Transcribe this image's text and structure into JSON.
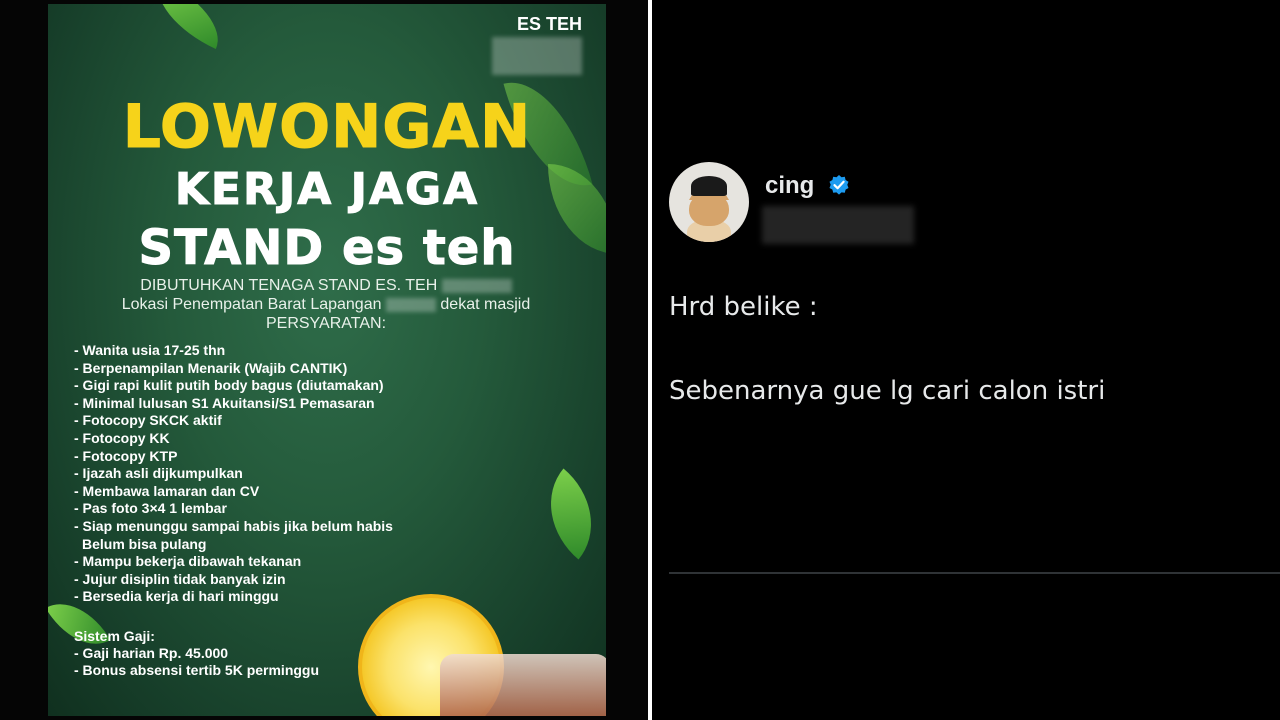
{
  "poster": {
    "brand": "ES TEH",
    "title_line1": "LOWONGAN",
    "title_line2": "KERJA JAGA",
    "title_line3": "STAND es teh",
    "intro_line1": "DIBUTUHKAN TENAGA STAND ES. TEH",
    "intro_line2a": "Lokasi Penempatan Barat Lapangan",
    "intro_line2b": "dekat masjid",
    "requirements_heading": "PERSYARATAN:",
    "requirements": [
      "- Wanita usia 17-25 thn",
      "- Berpenampilan Menarik (Wajib CANTIK)",
      "- Gigi rapi kulit putih body bagus (diutamakan)",
      "- Minimal lulusan S1 Akuitansi/S1 Pemasaran",
      "- Fotocopy SKCK aktif",
      "- Fotocopy KK",
      "- Fotocopy KTP",
      "- Ijazah asli dijkumpulkan",
      "- Membawa lamaran dan CV",
      "- Pas foto 3×4 1 lembar",
      "- Siap menunggu sampai habis jika belum habis",
      "  Belum bisa pulang",
      "- Mampu bekerja dibawah tekanan",
      "- Jujur disiplin tidak banyak izin",
      "- Bersedia kerja di hari minggu"
    ],
    "salary_heading": "Sistem Gaji:",
    "salary_items": [
      "- Gaji harian Rp. 45.000",
      "- Bonus absensi tertib  5K perminggu"
    ]
  },
  "tweet": {
    "display_name": "cing",
    "text_line1": "Hrd belike :",
    "text_line2": "Sebenarnya gue lg cari calon istri",
    "verified_color": "#1d9bf0"
  },
  "colors": {
    "poster_green": "#245a3b",
    "title_yellow": "#f6d31a",
    "background": "#000000"
  }
}
